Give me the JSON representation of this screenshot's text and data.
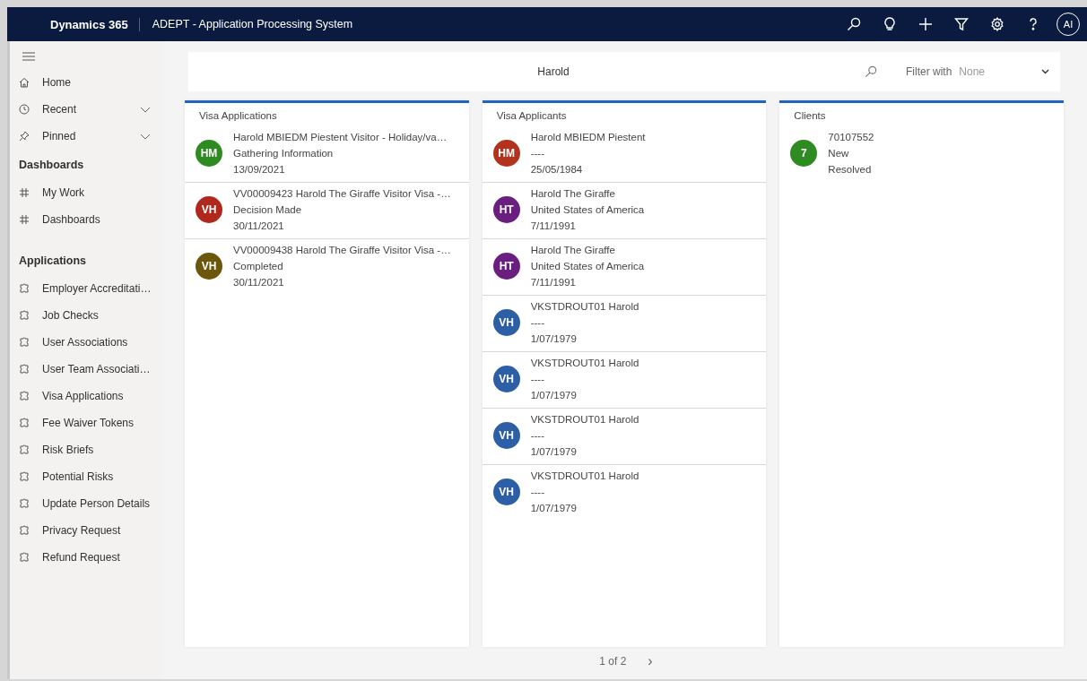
{
  "header": {
    "brand": "Dynamics 365",
    "app_title": "ADEPT - Application Processing System",
    "icons": [
      {
        "kind": "search"
      },
      {
        "kind": "lightbulb"
      },
      {
        "kind": "plus"
      },
      {
        "kind": "filter"
      },
      {
        "kind": "settings"
      },
      {
        "kind": "help"
      }
    ],
    "user_initials": "AI"
  },
  "sidebar": {
    "groups": [
      {
        "items": [
          {
            "label": "Home",
            "kind": "home"
          },
          {
            "label": "Recent",
            "kind": "recent"
          },
          {
            "label": "Pinned",
            "kind": "pinned"
          }
        ]
      },
      {
        "title": "Dashboards",
        "items": [
          {
            "label": "My Work",
            "kind": "dashboard"
          },
          {
            "label": "Dashboards",
            "kind": "dashboard"
          }
        ]
      },
      {
        "title": "Applications",
        "items": [
          {
            "label": "Employer Accreditati…",
            "kind": "entity"
          },
          {
            "label": "Job Checks",
            "kind": "entity"
          },
          {
            "label": "User Associations",
            "kind": "entity"
          },
          {
            "label": "User Team Associati…",
            "kind": "entity"
          },
          {
            "label": "Visa Applications",
            "kind": "entity"
          },
          {
            "label": "Fee Waiver Tokens",
            "kind": "entity"
          },
          {
            "label": "Risk Briefs",
            "kind": "entity"
          },
          {
            "label": "Potential Risks",
            "kind": "entity"
          },
          {
            "label": "Update Person Details",
            "kind": "entity"
          },
          {
            "label": "Privacy Request",
            "kind": "entity"
          },
          {
            "label": "Refund Request",
            "kind": "entity"
          }
        ]
      }
    ]
  },
  "search": {
    "value": "Harold",
    "filter_label": "Filter with",
    "filter_value": "None"
  },
  "columns": [
    {
      "title": "Visa Applications",
      "records": [
        {
          "initials": "HM",
          "color": "#2e8b22",
          "lines": [
            "Harold MBIEDM Piestent Visitor - Holiday/va…",
            "Gathering Information",
            "13/09/2021"
          ]
        },
        {
          "initials": "VH",
          "color": "#b0281c",
          "lines": [
            "VV00009423 Harold The Giraffe Visitor Visa -…",
            "Decision Made",
            "30/11/2021"
          ]
        },
        {
          "initials": "VH",
          "color": "#6b560c",
          "lines": [
            "VV00009438 Harold The Giraffe Visitor Visa -…",
            "Completed",
            "30/11/2021"
          ]
        }
      ]
    },
    {
      "title": "Visa Applicants",
      "records": [
        {
          "initials": "HM",
          "color": "#b3321e",
          "lines": [
            "Harold MBIEDM Piestent",
            "----",
            "25/05/1984"
          ]
        },
        {
          "initials": "HT",
          "color": "#6a1f80",
          "lines": [
            "Harold The Giraffe",
            "United States of America",
            "7/11/1991"
          ]
        },
        {
          "initials": "HT",
          "color": "#6a1f80",
          "lines": [
            "Harold The Giraffe",
            "United States of America",
            "7/11/1991"
          ]
        },
        {
          "initials": "VH",
          "color": "#2d5fa6",
          "lines": [
            "VKSTDROUT01 Harold",
            "----",
            "1/07/1979"
          ]
        },
        {
          "initials": "VH",
          "color": "#2d5fa6",
          "lines": [
            "VKSTDROUT01 Harold",
            "----",
            "1/07/1979"
          ]
        },
        {
          "initials": "VH",
          "color": "#2d5fa6",
          "lines": [
            "VKSTDROUT01 Harold",
            "----",
            "1/07/1979"
          ]
        },
        {
          "initials": "VH",
          "color": "#2d5fa6",
          "lines": [
            "VKSTDROUT01 Harold",
            "----",
            "1/07/1979"
          ]
        }
      ]
    },
    {
      "title": "Clients",
      "records": [
        {
          "initials": "7",
          "color": "#2e8b22",
          "lines": [
            "70107552",
            "New",
            "Resolved"
          ]
        }
      ]
    }
  ],
  "pager": {
    "text": "1 of 2",
    "next": "›"
  }
}
